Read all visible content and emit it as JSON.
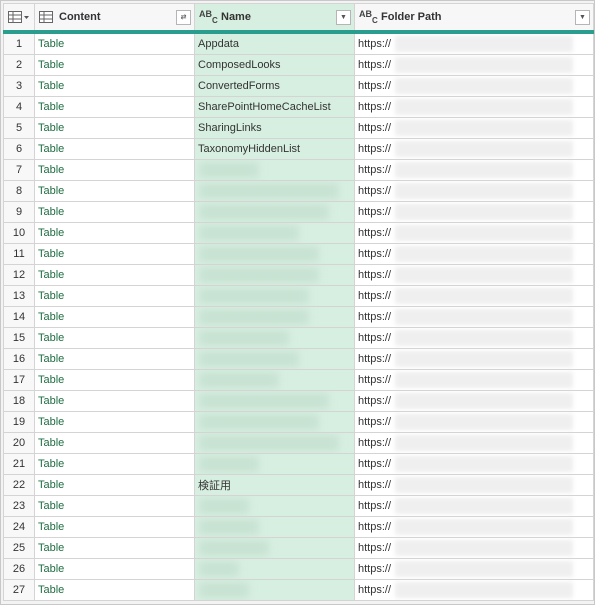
{
  "columns": {
    "content": {
      "label": "Content",
      "type_icon": "table-icon",
      "action_icon": "expand-columns-icon"
    },
    "name": {
      "label": "Name",
      "type_icon": "text-type-icon",
      "type_text": [
        "A",
        "B",
        "C"
      ],
      "filter_icon": "dropdown-icon"
    },
    "path": {
      "label": "Folder Path",
      "type_icon": "text-type-icon",
      "type_text": [
        "A",
        "B",
        "C"
      ],
      "filter_icon": "dropdown-icon"
    }
  },
  "accent_color": "#2a9d8f",
  "selected_column_bg": "#d7efe1",
  "rows": [
    {
      "index": "1",
      "content": "Table",
      "name": "Appdata",
      "path": "https://"
    },
    {
      "index": "2",
      "content": "Table",
      "name": "ComposedLooks",
      "path": "https://"
    },
    {
      "index": "3",
      "content": "Table",
      "name": "ConvertedForms",
      "path": "https://"
    },
    {
      "index": "4",
      "content": "Table",
      "name": "SharePointHomeCacheList",
      "path": "https://"
    },
    {
      "index": "5",
      "content": "Table",
      "name": "SharingLinks",
      "path": "https://"
    },
    {
      "index": "6",
      "content": "Table",
      "name": "TaxonomyHiddenList",
      "path": "https://"
    },
    {
      "index": "7",
      "content": "Table",
      "name": "",
      "path": "https://"
    },
    {
      "index": "8",
      "content": "Table",
      "name": "",
      "path": "https://"
    },
    {
      "index": "9",
      "content": "Table",
      "name": "",
      "path": "https://"
    },
    {
      "index": "10",
      "content": "Table",
      "name": "",
      "path": "https://"
    },
    {
      "index": "11",
      "content": "Table",
      "name": "",
      "path": "https://"
    },
    {
      "index": "12",
      "content": "Table",
      "name": "",
      "path": "https://"
    },
    {
      "index": "13",
      "content": "Table",
      "name": "",
      "path": "https://"
    },
    {
      "index": "14",
      "content": "Table",
      "name": "",
      "path": "https://"
    },
    {
      "index": "15",
      "content": "Table",
      "name": "",
      "path": "https://"
    },
    {
      "index": "16",
      "content": "Table",
      "name": "",
      "path": "https://"
    },
    {
      "index": "17",
      "content": "Table",
      "name": "",
      "path": "https://"
    },
    {
      "index": "18",
      "content": "Table",
      "name": "",
      "path": "https://"
    },
    {
      "index": "19",
      "content": "Table",
      "name": "",
      "path": "https://"
    },
    {
      "index": "20",
      "content": "Table",
      "name": "",
      "path": "https://"
    },
    {
      "index": "21",
      "content": "Table",
      "name": "",
      "path": "https://"
    },
    {
      "index": "22",
      "content": "Table",
      "name": "検証用",
      "path": "https://"
    },
    {
      "index": "23",
      "content": "Table",
      "name": "",
      "path": "https://"
    },
    {
      "index": "24",
      "content": "Table",
      "name": "",
      "path": "https://"
    },
    {
      "index": "25",
      "content": "Table",
      "name": "",
      "path": "https://"
    },
    {
      "index": "26",
      "content": "Table",
      "name": "",
      "path": "https://"
    },
    {
      "index": "27",
      "content": "Table",
      "name": "",
      "path": "https://"
    }
  ]
}
